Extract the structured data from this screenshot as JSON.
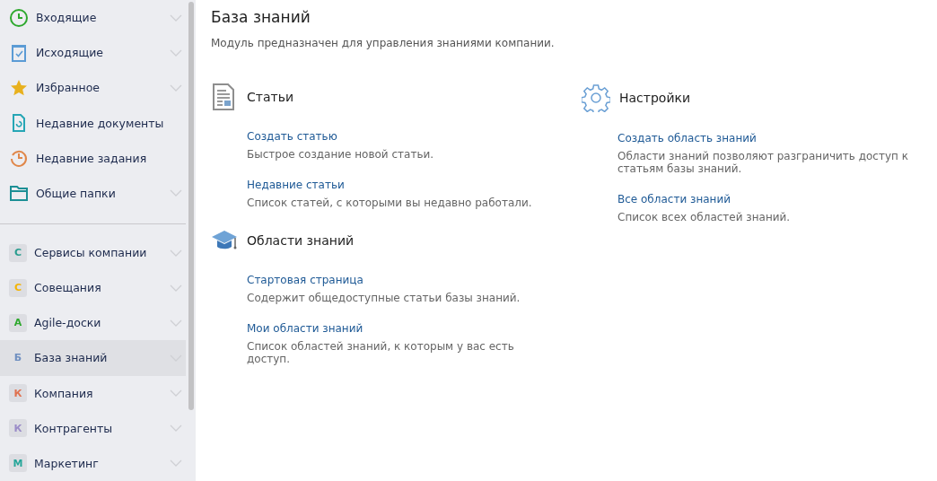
{
  "sidebar": {
    "nav_items": [
      {
        "kind": "clock",
        "label": "Входящие",
        "expandable": true
      },
      {
        "kind": "clipboard",
        "label": "Исходящие",
        "expandable": true
      },
      {
        "kind": "star",
        "label": "Избранное",
        "expandable": true
      },
      {
        "kind": "document",
        "label": "Недавние документы",
        "expandable": false
      },
      {
        "kind": "history",
        "label": "Недавние задания",
        "expandable": false
      },
      {
        "kind": "folder",
        "label": "Общие папки",
        "expandable": true
      }
    ],
    "apps": [
      {
        "letter": "С",
        "label": "Сервисы компании",
        "color": "#2a9d8f",
        "selected": false
      },
      {
        "letter": "С",
        "label": "Совещания",
        "color": "#f4b400",
        "selected": false
      },
      {
        "letter": "А",
        "label": "Agile-доски",
        "color": "#2ea82e",
        "selected": false
      },
      {
        "letter": "Б",
        "label": "База знаний",
        "color": "#6f8fc0",
        "selected": true
      },
      {
        "letter": "К",
        "label": "Компания",
        "color": "#e0714f",
        "selected": false
      },
      {
        "letter": "К",
        "label": "Контрагенты",
        "color": "#9a8cc8",
        "selected": false
      },
      {
        "letter": "М",
        "label": "Маркетинг",
        "color": "#26a69a",
        "selected": false
      }
    ]
  },
  "page": {
    "title": "База знаний",
    "subtitle": "Модуль предназначен для управления знаниями компании.",
    "columns": [
      [
        {
          "kind": "article",
          "title": "Статьи",
          "links": [
            {
              "label": "Создать статью",
              "description": "Быстрое создание новой статьи."
            },
            {
              "label": "Недавние статьи",
              "description": "Список статей, с которыми вы недавно работали."
            }
          ]
        },
        {
          "kind": "cap",
          "title": "Области знаний",
          "links": [
            {
              "label": "Стартовая страница",
              "description": "Содержит общедоступные статьи базы знаний."
            },
            {
              "label": "Мои области знаний",
              "description": "Список областей знаний, к которым у вас есть доступ."
            }
          ]
        }
      ],
      [
        {
          "kind": "gear",
          "title": "Настройки",
          "links": [
            {
              "label": "Создать область знаний",
              "description": "Области знаний позволяют разграничить доступ к статьям базы знаний."
            },
            {
              "label": "Все области знаний",
              "description": "Список всех областей знаний."
            }
          ]
        }
      ]
    ]
  }
}
